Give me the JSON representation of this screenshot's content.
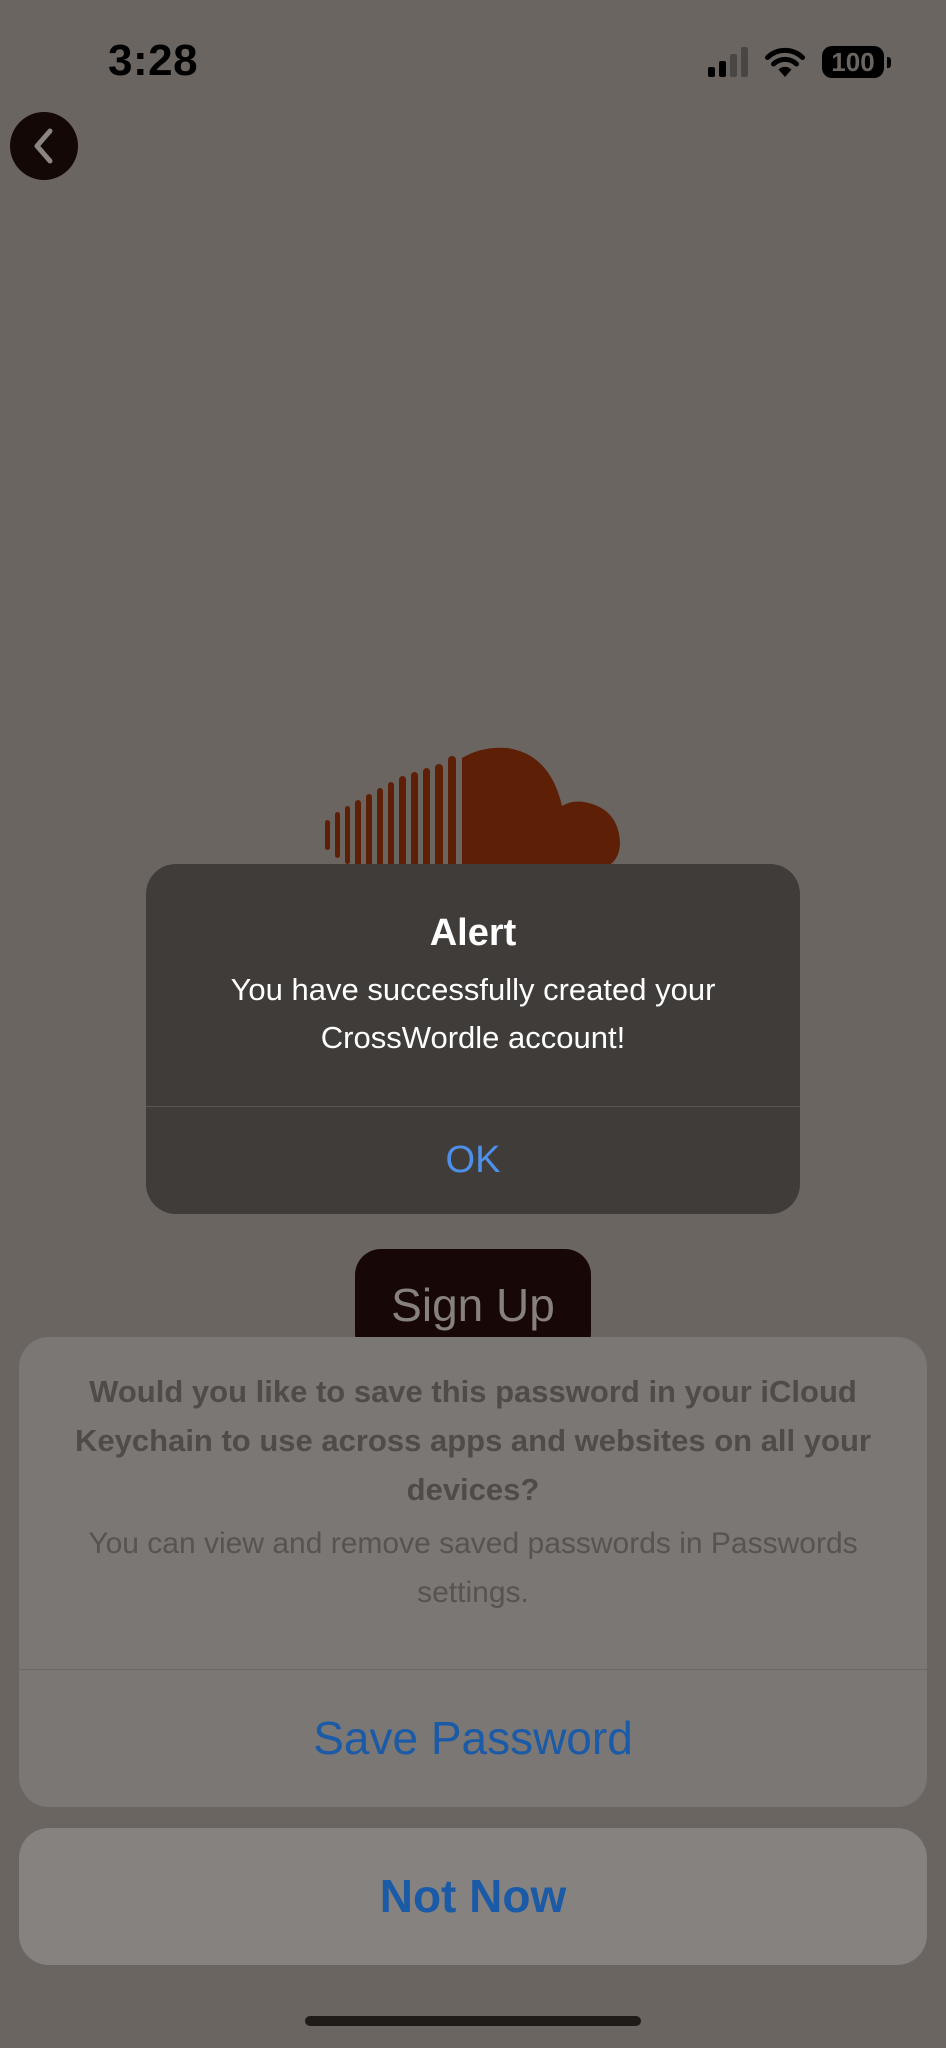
{
  "status_bar": {
    "time": "3:28",
    "battery": "100",
    "icons": [
      "signal-icon",
      "wifi-icon",
      "battery-icon"
    ]
  },
  "nav": {
    "back_icon": "chevron-left-icon"
  },
  "background": {
    "logo_icon": "cloud-logo-icon",
    "signup_label": "Sign Up"
  },
  "alert": {
    "title": "Alert",
    "message": "You have successfully created your CrossWordle account!",
    "ok_label": "OK"
  },
  "password_sheet": {
    "question": "Would you like to save this password in your iCloud Keychain to use across apps and websites on all your devices?",
    "note": "You can view and remove saved passwords in Passwords settings.",
    "save_label": "Save Password",
    "not_now_label": "Not Now"
  },
  "colors": {
    "dimmed_background": "#6a6561",
    "logo": "#5e1f07",
    "alert_background": "#403c39",
    "alert_button": "#4e90e8",
    "sheet_button": "#1b5aa6"
  }
}
